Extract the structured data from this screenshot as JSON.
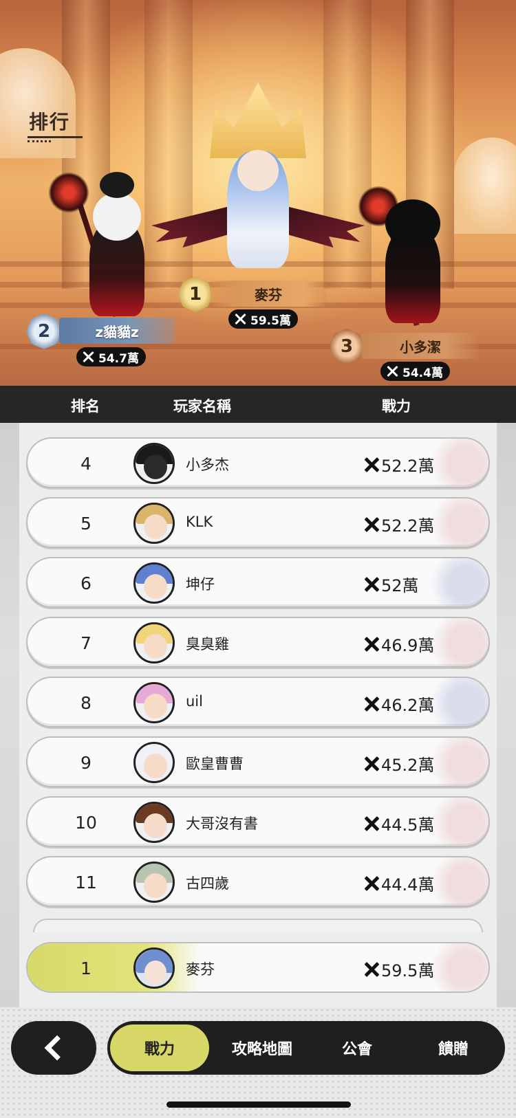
{
  "page": {
    "title": "排行"
  },
  "columns": {
    "rank": "排名",
    "player": "玩家名稱",
    "power": "戰力"
  },
  "podium": [
    {
      "rank": "1",
      "name": "麥芬",
      "power": "59.5萬"
    },
    {
      "rank": "2",
      "name": "z貓貓z",
      "power": "54.7萬"
    },
    {
      "rank": "3",
      "name": "小多潔",
      "power": "54.4萬"
    }
  ],
  "rows": [
    {
      "rank": "4",
      "name": "小多杰",
      "power": "52.2萬"
    },
    {
      "rank": "5",
      "name": "KLK",
      "power": "52.2萬"
    },
    {
      "rank": "6",
      "name": "坤仔",
      "power": "52萬"
    },
    {
      "rank": "7",
      "name": "臭臭雞",
      "power": "46.9萬"
    },
    {
      "rank": "8",
      "name": "uil",
      "power": "46.2萬"
    },
    {
      "rank": "9",
      "name": "歐皇曹曹",
      "power": "45.2萬"
    },
    {
      "rank": "10",
      "name": "大哥沒有書",
      "power": "44.5萬"
    },
    {
      "rank": "11",
      "name": "古四歲",
      "power": "44.4萬"
    }
  ],
  "self": {
    "rank": "1",
    "name": "麥芬",
    "power": "59.5萬"
  },
  "tabs": [
    {
      "label": "戰力",
      "active": true
    },
    {
      "label": "攻略地圖",
      "active": false
    },
    {
      "label": "公會",
      "active": false
    },
    {
      "label": "饋贈",
      "active": false
    }
  ],
  "icons": {
    "back": "chevron-left-icon",
    "power": "crossed-swords-icon"
  },
  "colors": {
    "accent": "#d6d767",
    "dark": "#1f1f1f",
    "header": "#262626"
  }
}
